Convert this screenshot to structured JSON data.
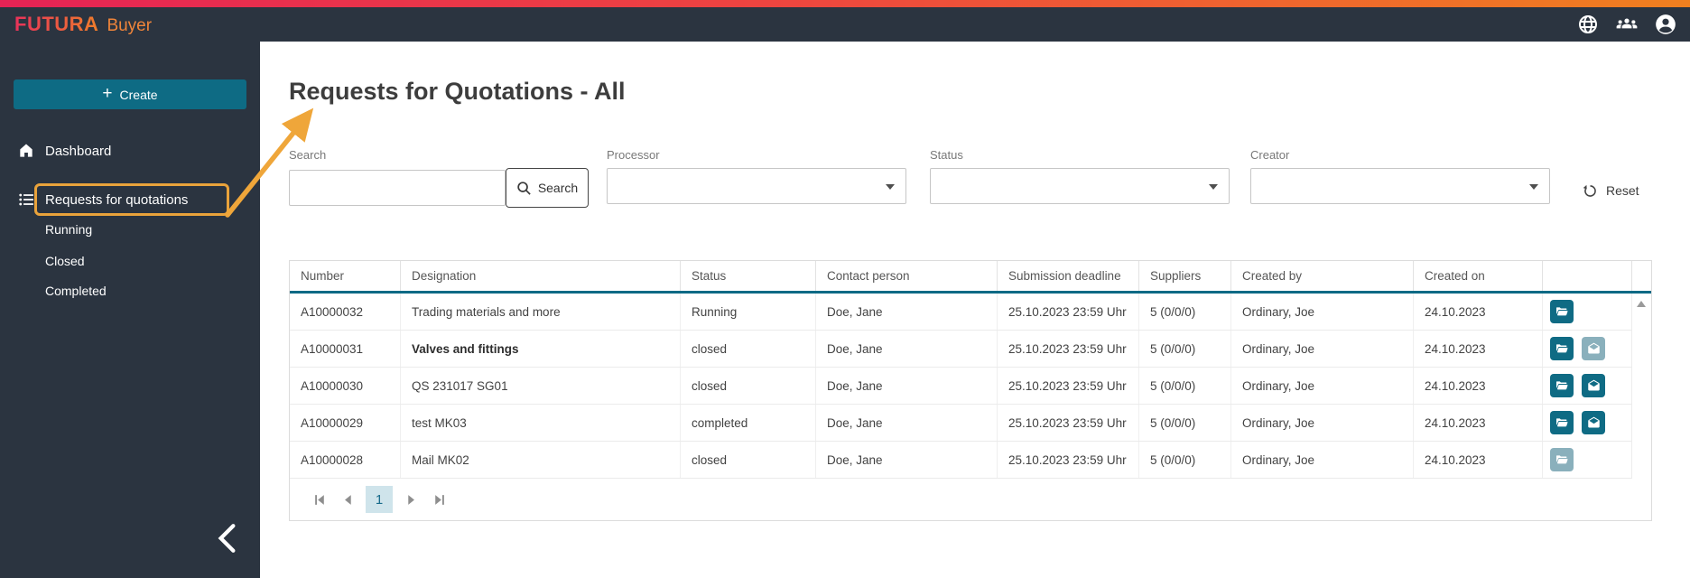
{
  "brand": {
    "name": "FUTURA",
    "product": "Buyer"
  },
  "topbar": {
    "icons": [
      "language",
      "groups",
      "account"
    ]
  },
  "sidebar": {
    "create_plus": "+",
    "create_button": "Create",
    "items": [
      {
        "label": "Dashboard"
      },
      {
        "label": "Requests for quotations"
      }
    ],
    "subitems": [
      {
        "label": "Running"
      },
      {
        "label": "Closed"
      },
      {
        "label": "Completed"
      }
    ]
  },
  "page": {
    "title": "Requests for Quotations - All"
  },
  "filters": {
    "search": {
      "label": "Search",
      "value": "",
      "button": "Search"
    },
    "processor": {
      "label": "Processor",
      "value": ""
    },
    "status": {
      "label": "Status",
      "value": ""
    },
    "creator": {
      "label": "Creator",
      "value": ""
    },
    "reset_label": "Reset"
  },
  "table": {
    "columns": [
      "Number",
      "Designation",
      "Status",
      "Contact person",
      "Submission deadline",
      "Suppliers",
      "Created by",
      "Created on"
    ],
    "rows": [
      {
        "number": "A10000032",
        "designation": "Trading materials and more",
        "designation_bold": false,
        "status": "Running",
        "contact_person": "Doe, Jane",
        "submission_deadline": "25.10.2023 23:59 Uhr",
        "suppliers": "5 (0/0/0)",
        "created_by": "Ordinary, Joe",
        "created_on": "24.10.2023",
        "actions": [
          {
            "icon": "folder-open",
            "muted": false
          }
        ]
      },
      {
        "number": "A10000031",
        "designation": "Valves and fittings",
        "designation_bold": true,
        "status": "closed",
        "contact_person": "Doe, Jane",
        "submission_deadline": "25.10.2023 23:59 Uhr",
        "suppliers": "5 (0/0/0)",
        "created_by": "Ordinary, Joe",
        "created_on": "24.10.2023",
        "actions": [
          {
            "icon": "folder-open",
            "muted": false
          },
          {
            "icon": "drafts",
            "muted": true
          }
        ]
      },
      {
        "number": "A10000030",
        "designation": "QS 231017 SG01",
        "designation_bold": false,
        "status": "closed",
        "contact_person": "Doe, Jane",
        "submission_deadline": "25.10.2023 23:59 Uhr",
        "suppliers": "5 (0/0/0)",
        "created_by": "Ordinary, Joe",
        "created_on": "24.10.2023",
        "actions": [
          {
            "icon": "folder-open",
            "muted": false
          },
          {
            "icon": "drafts",
            "muted": false
          }
        ]
      },
      {
        "number": "A10000029",
        "designation": "test MK03",
        "designation_bold": false,
        "status": "completed",
        "contact_person": "Doe, Jane",
        "submission_deadline": "25.10.2023 23:59 Uhr",
        "suppliers": "5 (0/0/0)",
        "created_by": "Ordinary, Joe",
        "created_on": "24.10.2023",
        "actions": [
          {
            "icon": "folder-open",
            "muted": false
          },
          {
            "icon": "drafts",
            "muted": false
          }
        ]
      },
      {
        "number": "A10000028",
        "designation": "Mail MK02",
        "designation_bold": false,
        "status": "closed",
        "contact_person": "Doe, Jane",
        "submission_deadline": "25.10.2023 23:59 Uhr",
        "suppliers": "5 (0/0/0)",
        "created_by": "Ordinary, Joe",
        "created_on": "24.10.2023",
        "actions": [
          {
            "icon": "folder-open",
            "muted": true
          }
        ]
      }
    ],
    "pagination": {
      "current_page": "1"
    }
  },
  "colors": {
    "teal": "#0e6b84",
    "sidebar_bg": "#2b3440",
    "strip_gradient": [
      "#e62355",
      "#ee4440",
      "#f0801f"
    ],
    "annotation_orange": "#efa63a",
    "muted_action": "#8ab0bc",
    "pagination_active_bg": "#cfe4eb"
  }
}
